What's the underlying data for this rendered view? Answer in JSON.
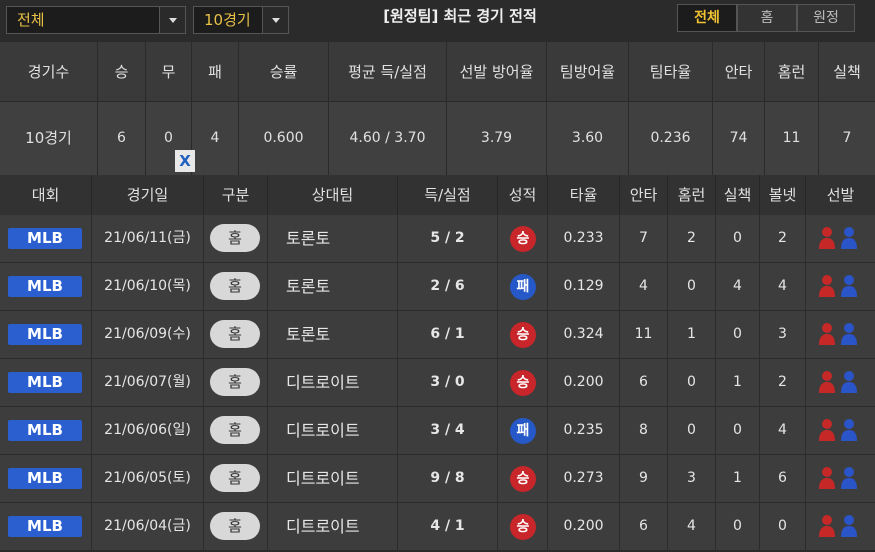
{
  "toolbar": {
    "filter_select": "전체",
    "count_select": "10경기",
    "title": "[원정팀] 최근 경기 전적",
    "tabs": [
      {
        "label": "전체",
        "active": true
      },
      {
        "label": "홈",
        "active": false
      },
      {
        "label": "원정",
        "active": false
      }
    ]
  },
  "summary": {
    "headers": [
      "경기수",
      "승",
      "무",
      "패",
      "승률",
      "평균 득/실점",
      "선발 방어율",
      "팀방어율",
      "팀타율",
      "안타",
      "홈런",
      "실책"
    ],
    "values": [
      "10경기",
      "6",
      "0",
      "4",
      "0.600",
      "4.60 / 3.70",
      "3.79",
      "3.60",
      "0.236",
      "74",
      "11",
      "7"
    ],
    "close_badge": "X"
  },
  "games": {
    "headers": [
      "대회",
      "경기일",
      "구분",
      "상대팀",
      "득/실점",
      "성적",
      "타율",
      "안타",
      "홈런",
      "실책",
      "볼넷",
      "선발"
    ],
    "rows": [
      {
        "league": "MLB",
        "date": "21/06/11(금)",
        "type": "홈",
        "opponent": "토론토",
        "score": "5 / 2",
        "result": "승",
        "avg": "0.233",
        "hits": "7",
        "hr": "2",
        "err": "0",
        "bb": "2"
      },
      {
        "league": "MLB",
        "date": "21/06/10(목)",
        "type": "홈",
        "opponent": "토론토",
        "score": "2 / 6",
        "result": "패",
        "avg": "0.129",
        "hits": "4",
        "hr": "0",
        "err": "4",
        "bb": "4"
      },
      {
        "league": "MLB",
        "date": "21/06/09(수)",
        "type": "홈",
        "opponent": "토론토",
        "score": "6 / 1",
        "result": "승",
        "avg": "0.324",
        "hits": "11",
        "hr": "1",
        "err": "0",
        "bb": "3"
      },
      {
        "league": "MLB",
        "date": "21/06/07(월)",
        "type": "홈",
        "opponent": "디트로이트",
        "score": "3 / 0",
        "result": "승",
        "avg": "0.200",
        "hits": "6",
        "hr": "0",
        "err": "1",
        "bb": "2"
      },
      {
        "league": "MLB",
        "date": "21/06/06(일)",
        "type": "홈",
        "opponent": "디트로이트",
        "score": "3 / 4",
        "result": "패",
        "avg": "0.235",
        "hits": "8",
        "hr": "0",
        "err": "0",
        "bb": "4"
      },
      {
        "league": "MLB",
        "date": "21/06/05(토)",
        "type": "홈",
        "opponent": "디트로이트",
        "score": "9 / 8",
        "result": "승",
        "avg": "0.273",
        "hits": "9",
        "hr": "3",
        "err": "1",
        "bb": "6"
      },
      {
        "league": "MLB",
        "date": "21/06/04(금)",
        "type": "홈",
        "opponent": "디트로이트",
        "score": "4 / 1",
        "result": "승",
        "avg": "0.200",
        "hits": "6",
        "hr": "4",
        "err": "0",
        "bb": "0"
      }
    ]
  },
  "colors": {
    "accent": "#f0c232",
    "win": "#c8262b",
    "loss": "#2658c8",
    "league_badge": "#2b5fd0",
    "home_pitcher_icon": "#c62828",
    "away_pitcher_icon": "#2a55c8"
  },
  "icons": {
    "dropdown": "chevron-down-icon",
    "home_pitcher": "person-red-icon",
    "away_pitcher": "person-blue-icon"
  }
}
